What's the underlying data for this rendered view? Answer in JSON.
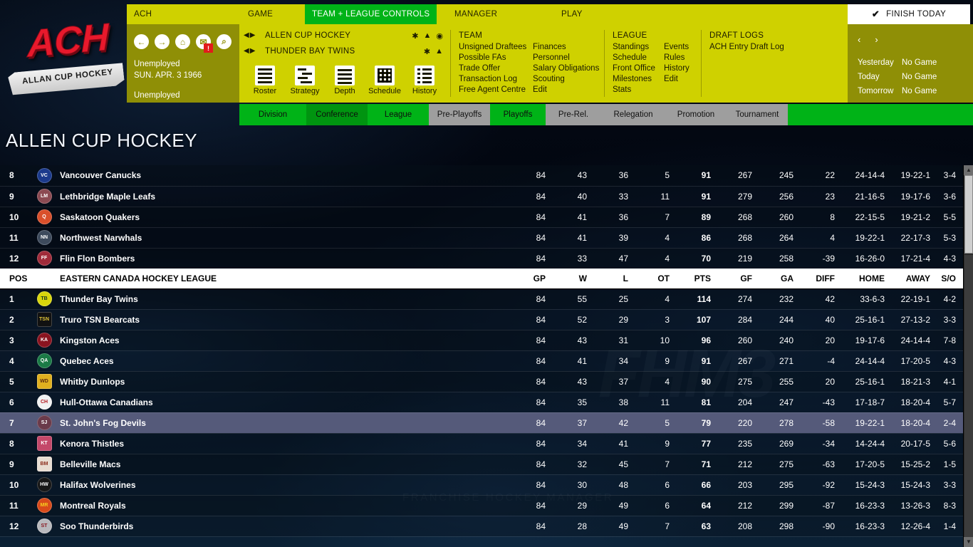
{
  "logo": {
    "title": "ACH",
    "subtitle": "ALLAN CUP HOCKEY"
  },
  "menubar": {
    "items": [
      {
        "label": "ACH",
        "active": false
      },
      {
        "label": "GAME",
        "active": false
      },
      {
        "label": "TEAM + LEAGUE CONTROLS",
        "active": true
      },
      {
        "label": "MANAGER",
        "active": false
      },
      {
        "label": "PLAY",
        "active": false
      }
    ],
    "finish_today": "FINISH TODAY",
    "check_icon": "✔"
  },
  "header_left": {
    "icons": [
      {
        "name": "back-arrow-icon",
        "glyph": "←"
      },
      {
        "name": "forward-arrow-icon",
        "glyph": "→"
      },
      {
        "name": "home-icon",
        "glyph": "⌂"
      },
      {
        "name": "mail-icon",
        "glyph": "✉",
        "badge": "!"
      },
      {
        "name": "search-icon",
        "glyph": "⌕"
      }
    ],
    "status": "Unemployed",
    "date": "SUN. APR. 3 1966",
    "role": "Unemployed"
  },
  "header_mid": {
    "rows": [
      {
        "name": "ALLEN CUP HOCKEY",
        "icons": [
          "chevron-double-down-icon",
          "home-icon",
          "globe-icon"
        ]
      },
      {
        "name": "THUNDER BAY TWINS",
        "icons": [
          "chevron-double-down-icon",
          "home-icon"
        ]
      }
    ],
    "quicknav": [
      {
        "label": "Roster",
        "icon": "roster-icon"
      },
      {
        "label": "Strategy",
        "icon": "strategy-icon"
      },
      {
        "label": "Depth",
        "icon": "depth-icon"
      },
      {
        "label": "Schedule",
        "icon": "schedule-icon"
      },
      {
        "label": "History",
        "icon": "history-icon"
      }
    ]
  },
  "header_menus": [
    {
      "title": "TEAM",
      "columns": [
        [
          "Unsigned Draftees",
          "Possible FAs",
          "Trade Offer",
          "Transaction Log",
          "Free Agent Centre"
        ],
        [
          "Finances",
          "Personnel",
          "Salary Obligations",
          "Scouting",
          "Edit"
        ]
      ]
    },
    {
      "title": "LEAGUE",
      "columns": [
        [
          "Standings",
          "Schedule",
          "Front Office",
          "Milestones",
          "Stats"
        ],
        [
          "Events",
          "Rules",
          "History",
          "Edit"
        ]
      ]
    },
    {
      "title": "DRAFT LOGS",
      "columns": [
        [
          "ACH Entry Draft Log"
        ]
      ]
    }
  ],
  "date_panel": {
    "prev_icon": "‹",
    "next_icon": "›",
    "rows": [
      {
        "key": "Yesterday",
        "value": "No Game"
      },
      {
        "key": "Today",
        "value": "No Game"
      },
      {
        "key": "Tomorrow",
        "value": "No Game"
      }
    ]
  },
  "subtabs": [
    {
      "label": "Division",
      "state": "green"
    },
    {
      "label": "Conference",
      "state": "dark"
    },
    {
      "label": "League",
      "state": "green"
    },
    {
      "label": "Pre-Playoffs",
      "state": "grey"
    },
    {
      "label": "Playoffs",
      "state": "green"
    },
    {
      "label": "Pre-Rel.",
      "state": "grey"
    },
    {
      "label": "Relegation",
      "state": "grey"
    },
    {
      "label": "Promotion",
      "state": "grey"
    },
    {
      "label": "Tournament",
      "state": "grey"
    }
  ],
  "page_title": "ALLEN CUP HOCKEY",
  "watermark": {
    "big": "FHM3",
    "small": "FRANCHISE HOCKEY MANAGER"
  },
  "table": {
    "columns": [
      "POS",
      "",
      "EASTERN CANADA HOCKEY LEAGUE",
      "GP",
      "W",
      "L",
      "OT",
      "PTS",
      "GF",
      "GA",
      "DIFF",
      "HOME",
      "AWAY",
      "S/O"
    ],
    "header_label": "EASTERN CANADA HOCKEY LEAGUE",
    "header_pos": "POS",
    "rows_top": [
      {
        "pos": "8",
        "team": "Vancouver Canucks",
        "logo": {
          "bg": "#1b3a8c",
          "fg": "#ffffff",
          "text": "VC",
          "shape": "circle"
        },
        "gp": "84",
        "w": "43",
        "l": "36",
        "ot": "5",
        "pts": "91",
        "gf": "267",
        "ga": "245",
        "diff": "22",
        "home": "24-14-4",
        "away": "19-22-1",
        "so": "3-4"
      },
      {
        "pos": "9",
        "team": "Lethbridge Maple Leafs",
        "logo": {
          "bg": "#8c4a52",
          "fg": "#ffffff",
          "text": "LM",
          "shape": "circle"
        },
        "gp": "84",
        "w": "40",
        "l": "33",
        "ot": "11",
        "pts": "91",
        "gf": "279",
        "ga": "256",
        "diff": "23",
        "home": "21-16-5",
        "away": "19-17-6",
        "so": "3-6"
      },
      {
        "pos": "10",
        "team": "Saskatoon Quakers",
        "logo": {
          "bg": "#d94f2b",
          "fg": "#ffffff",
          "text": "Q",
          "shape": "circle"
        },
        "gp": "84",
        "w": "41",
        "l": "36",
        "ot": "7",
        "pts": "89",
        "gf": "268",
        "ga": "260",
        "diff": "8",
        "home": "22-15-5",
        "away": "19-21-2",
        "so": "5-5"
      },
      {
        "pos": "11",
        "team": "Northwest Narwhals",
        "logo": {
          "bg": "#3d4a5c",
          "fg": "#ffffff",
          "text": "NN",
          "shape": "circle"
        },
        "gp": "84",
        "w": "41",
        "l": "39",
        "ot": "4",
        "pts": "86",
        "gf": "268",
        "ga": "264",
        "diff": "4",
        "home": "19-22-1",
        "away": "22-17-3",
        "so": "5-3"
      },
      {
        "pos": "12",
        "team": "Flin Flon Bombers",
        "logo": {
          "bg": "#a02b3a",
          "fg": "#ffffff",
          "text": "FF",
          "shape": "circle"
        },
        "gp": "84",
        "w": "33",
        "l": "47",
        "ot": "4",
        "pts": "70",
        "gf": "219",
        "ga": "258",
        "diff": "-39",
        "home": "16-26-0",
        "away": "17-21-4",
        "so": "4-3"
      }
    ],
    "rows_bottom": [
      {
        "pos": "1",
        "team": "Thunder Bay Twins",
        "logo": {
          "bg": "#d9d60c",
          "fg": "#1b3a20",
          "text": "TB",
          "shape": "circle"
        },
        "gp": "84",
        "w": "55",
        "l": "25",
        "ot": "4",
        "pts": "114",
        "gf": "274",
        "ga": "232",
        "diff": "42",
        "home": "33-6-3",
        "away": "22-19-1",
        "so": "4-2",
        "selected": false
      },
      {
        "pos": "2",
        "team": "Truro TSN Bearcats",
        "logo": {
          "bg": "#111111",
          "fg": "#e0c43a",
          "text": "TSN",
          "shape": "square"
        },
        "gp": "84",
        "w": "52",
        "l": "29",
        "ot": "3",
        "pts": "107",
        "gf": "284",
        "ga": "244",
        "diff": "40",
        "home": "25-16-1",
        "away": "27-13-2",
        "so": "3-3",
        "selected": false
      },
      {
        "pos": "3",
        "team": "Kingston Aces",
        "logo": {
          "bg": "#8a1420",
          "fg": "#ffffff",
          "text": "KA",
          "shape": "circle"
        },
        "gp": "84",
        "w": "43",
        "l": "31",
        "ot": "10",
        "pts": "96",
        "gf": "260",
        "ga": "240",
        "diff": "20",
        "home": "19-17-6",
        "away": "24-14-4",
        "so": "7-8",
        "selected": false
      },
      {
        "pos": "4",
        "team": "Quebec Aces",
        "logo": {
          "bg": "#1b7a46",
          "fg": "#ffffff",
          "text": "QA",
          "shape": "circle"
        },
        "gp": "84",
        "w": "41",
        "l": "34",
        "ot": "9",
        "pts": "91",
        "gf": "267",
        "ga": "271",
        "diff": "-4",
        "home": "24-14-4",
        "away": "17-20-5",
        "so": "4-3",
        "selected": false
      },
      {
        "pos": "5",
        "team": "Whitby Dunlops",
        "logo": {
          "bg": "#e0b01f",
          "fg": "#5c2b10",
          "text": "WD",
          "shape": "square"
        },
        "gp": "84",
        "w": "43",
        "l": "37",
        "ot": "4",
        "pts": "90",
        "gf": "275",
        "ga": "255",
        "diff": "20",
        "home": "25-16-1",
        "away": "18-21-3",
        "so": "4-1",
        "selected": false
      },
      {
        "pos": "6",
        "team": "Hull-Ottawa Canadians",
        "logo": {
          "bg": "#f2f2f2",
          "fg": "#b4191f",
          "text": "CH",
          "shape": "circle"
        },
        "gp": "84",
        "w": "35",
        "l": "38",
        "ot": "11",
        "pts": "81",
        "gf": "204",
        "ga": "247",
        "diff": "-43",
        "home": "17-18-7",
        "away": "18-20-4",
        "so": "5-7",
        "selected": false
      },
      {
        "pos": "7",
        "team": "St. John's Fog Devils",
        "logo": {
          "bg": "#6a3a4a",
          "fg": "#ffffff",
          "text": "SJ",
          "shape": "circle"
        },
        "gp": "84",
        "w": "37",
        "l": "42",
        "ot": "5",
        "pts": "79",
        "gf": "220",
        "ga": "278",
        "diff": "-58",
        "home": "19-22-1",
        "away": "18-20-4",
        "so": "2-4",
        "selected": true
      },
      {
        "pos": "8",
        "team": "Kenora Thistles",
        "logo": {
          "bg": "#c4486a",
          "fg": "#ffffff",
          "text": "KT",
          "shape": "square"
        },
        "gp": "84",
        "w": "34",
        "l": "41",
        "ot": "9",
        "pts": "77",
        "gf": "235",
        "ga": "269",
        "diff": "-34",
        "home": "14-24-4",
        "away": "20-17-5",
        "so": "5-6",
        "selected": false
      },
      {
        "pos": "9",
        "team": "Belleville Macs",
        "logo": {
          "bg": "#e8ddd2",
          "fg": "#8a2b1a",
          "text": "BM",
          "shape": "square"
        },
        "gp": "84",
        "w": "32",
        "l": "45",
        "ot": "7",
        "pts": "71",
        "gf": "212",
        "ga": "275",
        "diff": "-63",
        "home": "17-20-5",
        "away": "15-25-2",
        "so": "1-5",
        "selected": false
      },
      {
        "pos": "10",
        "team": "Halifax Wolverines",
        "logo": {
          "bg": "#171717",
          "fg": "#ffffff",
          "text": "HW",
          "shape": "circle"
        },
        "gp": "84",
        "w": "30",
        "l": "48",
        "ot": "6",
        "pts": "66",
        "gf": "203",
        "ga": "295",
        "diff": "-92",
        "home": "15-24-3",
        "away": "15-24-3",
        "so": "3-3",
        "selected": false
      },
      {
        "pos": "11",
        "team": "Montreal Royals",
        "logo": {
          "bg": "#d94b1a",
          "fg": "#f5d020",
          "text": "MR",
          "shape": "circle"
        },
        "gp": "84",
        "w": "29",
        "l": "49",
        "ot": "6",
        "pts": "64",
        "gf": "212",
        "ga": "299",
        "diff": "-87",
        "home": "16-23-3",
        "away": "13-26-3",
        "so": "8-3",
        "selected": false
      },
      {
        "pos": "12",
        "team": "Soo Thunderbirds",
        "logo": {
          "bg": "#b9b9bd",
          "fg": "#8a1820",
          "text": "ST",
          "shape": "circle"
        },
        "gp": "84",
        "w": "28",
        "l": "49",
        "ot": "7",
        "pts": "63",
        "gf": "208",
        "ga": "298",
        "diff": "-90",
        "home": "16-23-3",
        "away": "12-26-4",
        "so": "1-4",
        "selected": false
      }
    ]
  }
}
